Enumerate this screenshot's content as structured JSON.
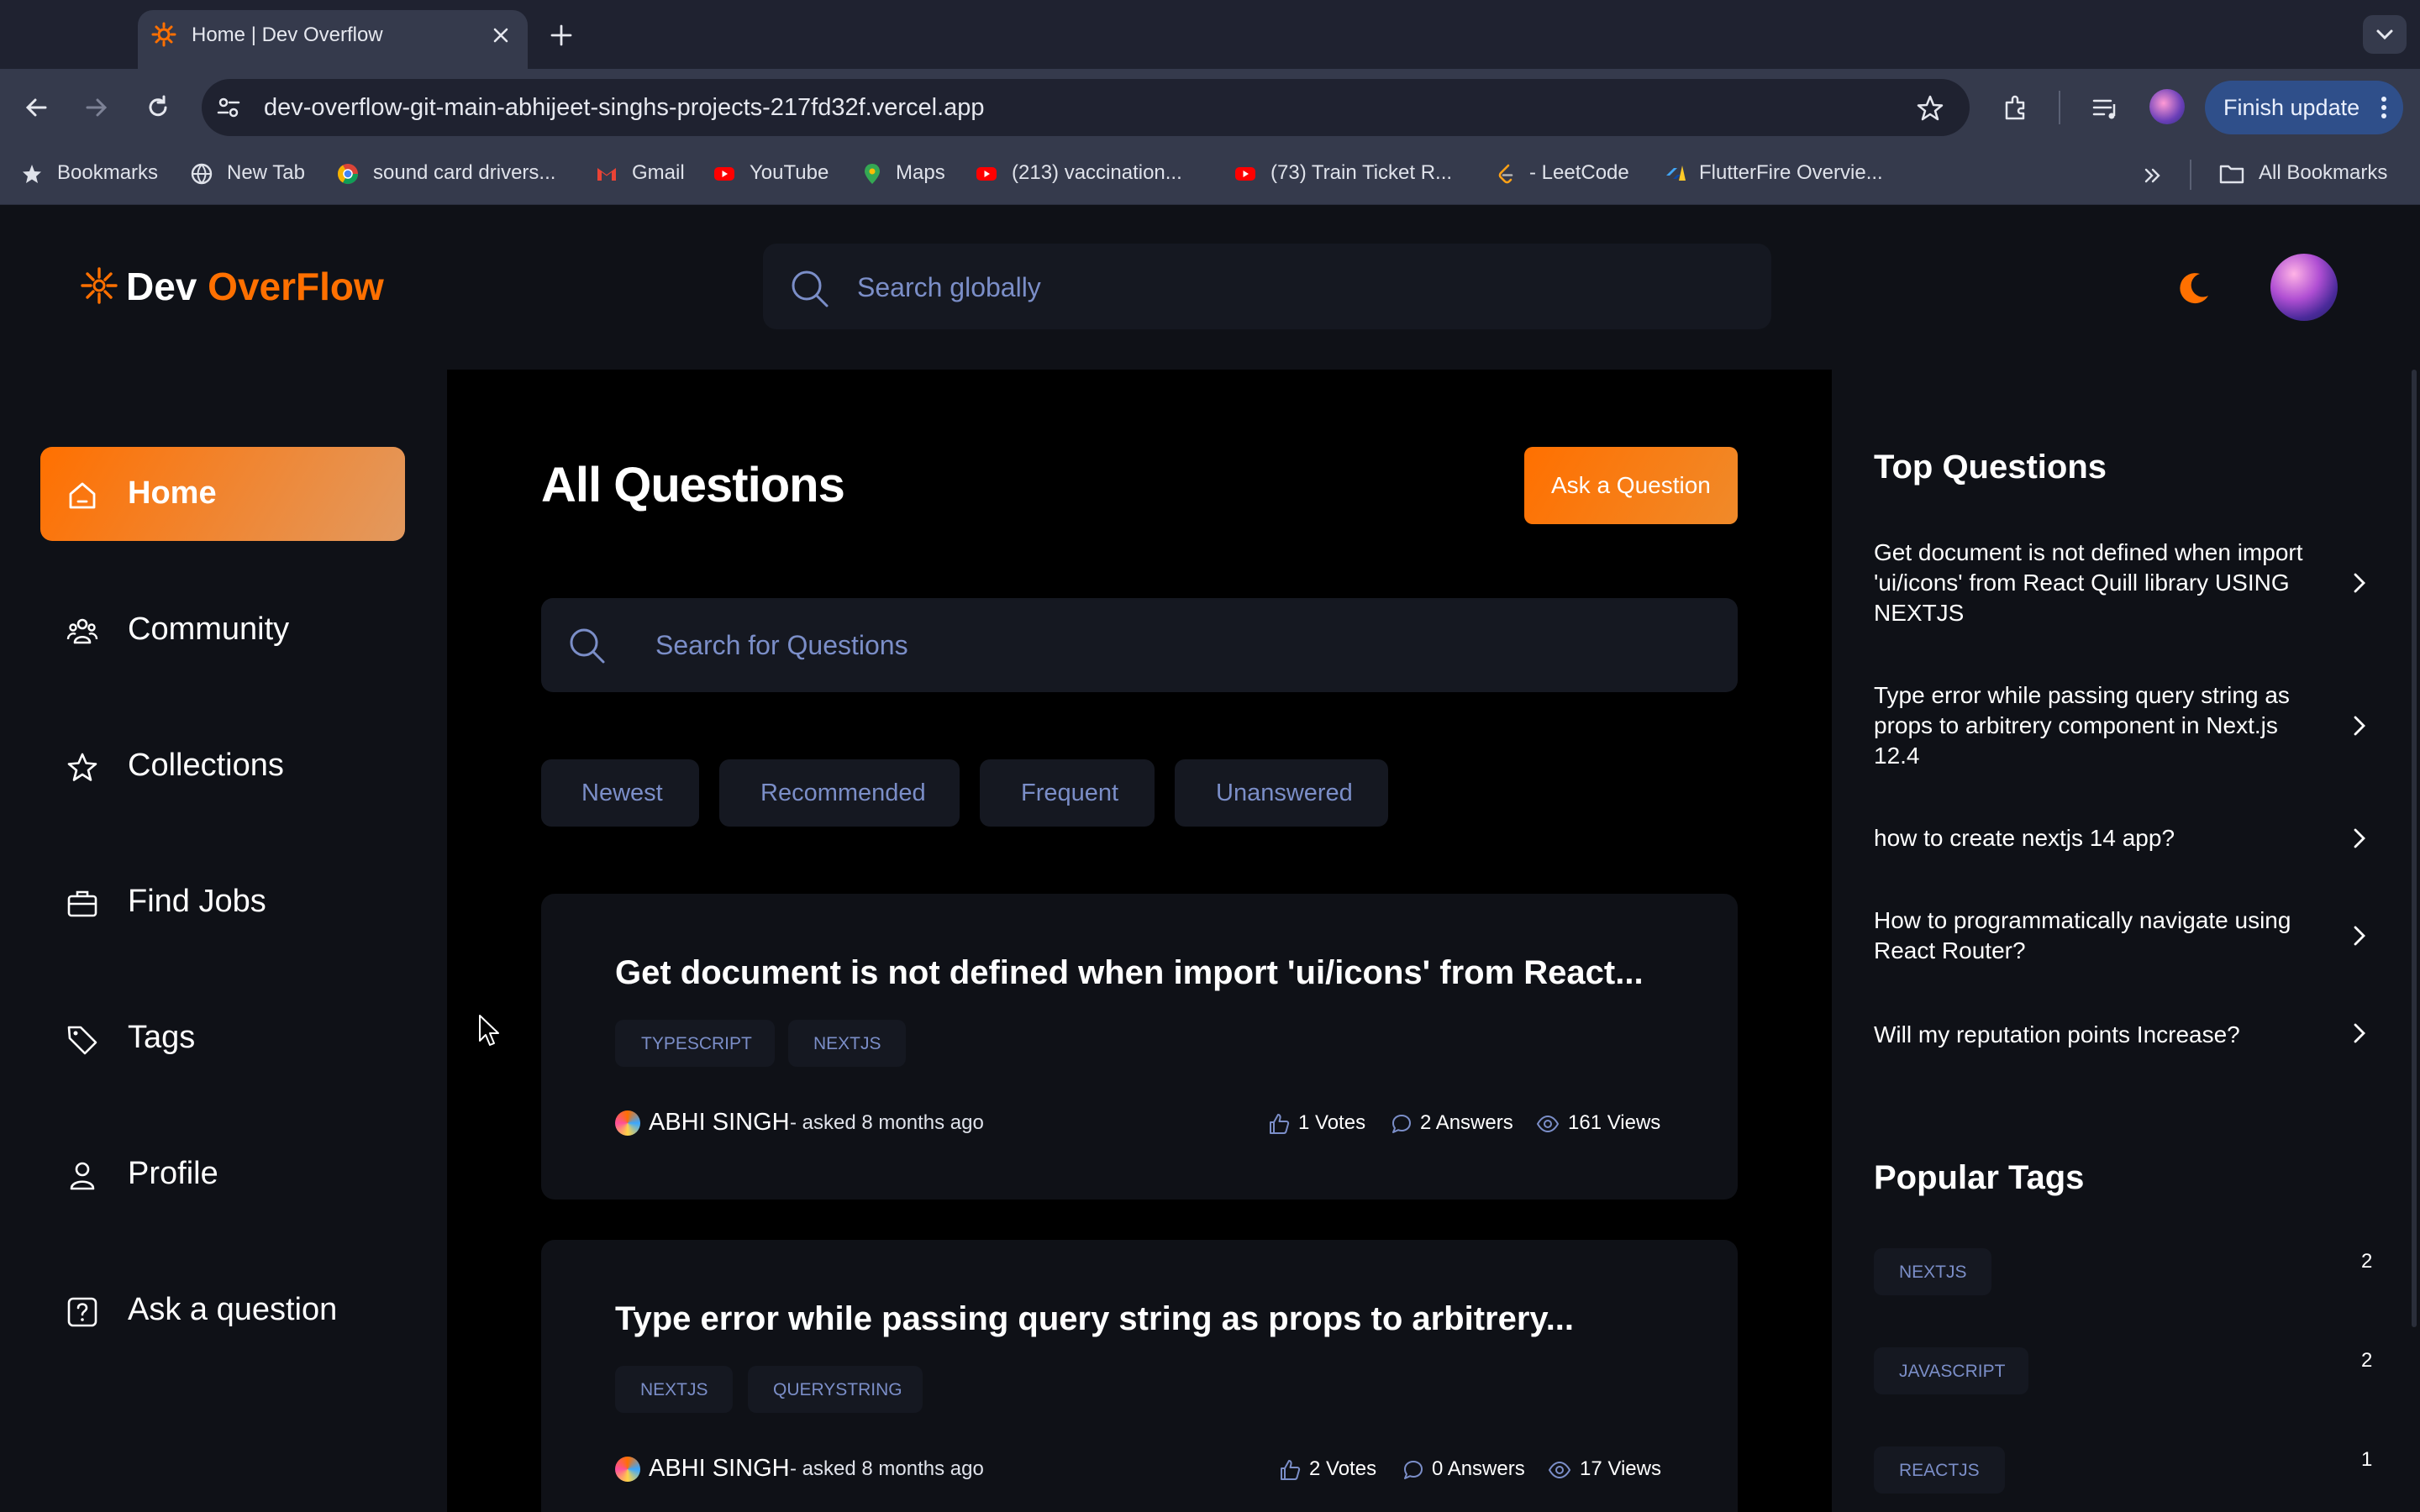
{
  "browser": {
    "tab_title": "Home | Dev Overflow",
    "url": "dev-overflow-git-main-abhijeet-singhs-projects-217fd32f.vercel.app",
    "finish_update": "Finish update",
    "bookmarks": [
      {
        "label": "Bookmarks",
        "icon": "star-icon"
      },
      {
        "label": "New Tab",
        "icon": "globe-icon"
      },
      {
        "label": "sound card drivers...",
        "icon": "chrome-icon"
      },
      {
        "label": "Gmail",
        "icon": "gmail-icon"
      },
      {
        "label": "YouTube",
        "icon": "youtube-icon"
      },
      {
        "label": "Maps",
        "icon": "maps-icon"
      },
      {
        "label": "(213) vaccination...",
        "icon": "youtube-icon"
      },
      {
        "label": "(73) Train Ticket R...",
        "icon": "youtube-icon"
      },
      {
        "label": "- LeetCode",
        "icon": "leetcode-icon"
      },
      {
        "label": "FlutterFire Overvie...",
        "icon": "flutterfire-icon"
      }
    ],
    "all_bookmarks": "All Bookmarks"
  },
  "header": {
    "logo_part1": "Dev ",
    "logo_part2": "OverFlow",
    "search_placeholder": "Search globally"
  },
  "sidebar": {
    "items": [
      {
        "label": "Home",
        "icon": "home-icon",
        "active": true
      },
      {
        "label": "Community",
        "icon": "users-icon"
      },
      {
        "label": "Collections",
        "icon": "star-icon"
      },
      {
        "label": "Find Jobs",
        "icon": "briefcase-icon"
      },
      {
        "label": "Tags",
        "icon": "tag-icon"
      },
      {
        "label": "Profile",
        "icon": "user-icon"
      },
      {
        "label": "Ask a question",
        "icon": "question-icon"
      }
    ]
  },
  "main": {
    "title": "All Questions",
    "ask_button": "Ask a Question",
    "search_placeholder": "Search for Questions",
    "filters": [
      "Newest",
      "Recommended",
      "Frequent",
      "Unanswered"
    ],
    "questions": [
      {
        "title": "Get document is not defined when import 'ui/icons' from React...",
        "tags": [
          "TYPESCRIPT",
          "NEXTJS"
        ],
        "author": "ABHI SINGH",
        "asked": "- asked 8 months ago",
        "votes": "1 Votes",
        "answers": "2 Answers",
        "views": "161 Views"
      },
      {
        "title": "Type error while passing query string as props to arbitrery...",
        "tags": [
          "NEXTJS",
          "QUERYSTRING"
        ],
        "author": "ABHI SINGH",
        "asked": "- asked 8 months ago",
        "votes": "2 Votes",
        "answers": "0 Answers",
        "views": "17 Views"
      }
    ]
  },
  "right_sidebar": {
    "top_questions_heading": "Top Questions",
    "top_questions": [
      "Get document is not defined when import 'ui/icons' from React Quill library USING NEXTJS",
      "Type error while passing query string as props to arbitrery component in Next.js 12.4",
      "how to create nextjs 14 app?",
      "How to programmatically navigate using React Router?",
      "Will my reputation points Increase?"
    ],
    "popular_tags_heading": "Popular Tags",
    "popular_tags": [
      {
        "name": "NEXTJS",
        "count": "2"
      },
      {
        "name": "JAVASCRIPT",
        "count": "2"
      },
      {
        "name": "REACTJS",
        "count": "1"
      }
    ]
  },
  "colors": {
    "accent": "#ff7000",
    "background": "#000000",
    "surface": "#0f1117",
    "muted_text": "#7b8ec8"
  }
}
